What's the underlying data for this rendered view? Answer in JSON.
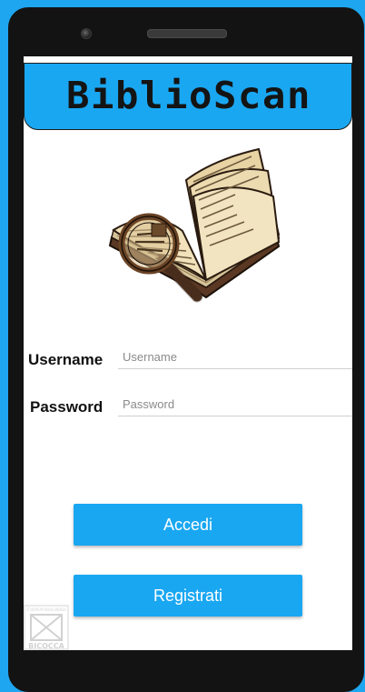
{
  "app": {
    "title": "BiblioScan",
    "brand_color": "#1aa7f2"
  },
  "logo": {
    "icon": "book-magnifier-icon"
  },
  "form": {
    "username_label": "Username",
    "username_placeholder": "Username",
    "password_label": "Password",
    "password_placeholder": "Password"
  },
  "buttons": {
    "login_label": "Accedi",
    "register_label": "Registrati"
  },
  "watermark": {
    "text": "BICOCCA",
    "small_text": "STUDIORUM MEDIOLANENSIS"
  }
}
